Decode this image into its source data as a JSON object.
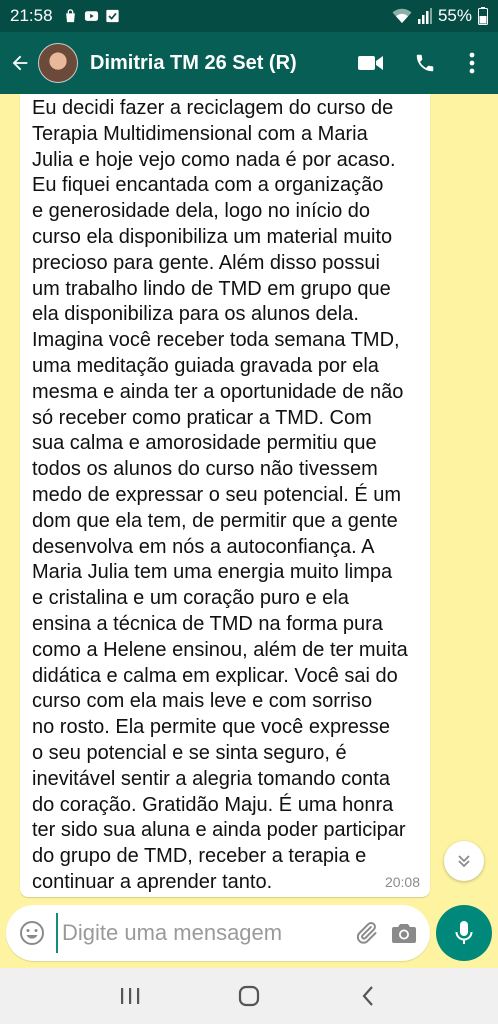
{
  "status_bar": {
    "time": "21:58",
    "battery": "55%",
    "left_icons": [
      "bag-icon",
      "youtube-icon",
      "check-box-icon"
    ],
    "right_icons": [
      "wifi-icon",
      "signal-icon",
      "battery-icon"
    ]
  },
  "header": {
    "contact_name": "Dimitria TM 26 Set (R)",
    "colors": {
      "bar": "#075e54",
      "status": "#054d44"
    }
  },
  "message": {
    "text": "Eu decidi fazer a reciclagem do curso de\nTerapia Multidimensional com a Maria\nJulia e hoje vejo como nada é por acaso.\nEu fiquei encantada com a organização\ne generosidade dela, logo no início do\ncurso ela disponibiliza  um material muito\nprecioso para gente. Além disso possui\num trabalho lindo de TMD em grupo que\nela disponibiliza para os alunos dela.\nImagina você receber toda semana TMD,\numa meditação guiada gravada por ela\nmesma e ainda ter a oportunidade de não\nsó receber como praticar a TMD. Com\nsua calma e amorosidade permitiu que\ntodos os alunos do curso não tivessem\nmedo de expressar o seu potencial. É um\ndom que ela tem, de permitir que a gente\ndesenvolva em nós a autoconfiança.  A\nMaria Julia tem uma energia muito limpa\ne cristalina e um coração puro e ela\nensina a técnica de TMD na forma pura\ncomo a Helene ensinou, além de ter muita\ndidática e calma em explicar. Você sai do\ncurso com ela mais leve e com sorriso\nno rosto. Ela permite que você expresse\no seu potencial e se sinta seguro, é\ninevitável sentir a alegria tomando conta\ndo coração. Gratidão Maju. É uma honra\nter sido sua aluna e ainda poder participar\ndo grupo de TMD, receber a terapia e\ncontinuar a aprender tanto.",
    "time": "20:08"
  },
  "composer": {
    "placeholder": "Digite uma mensagem"
  },
  "colors": {
    "chat_background": "#fdf3a0",
    "accent": "#00897b"
  }
}
